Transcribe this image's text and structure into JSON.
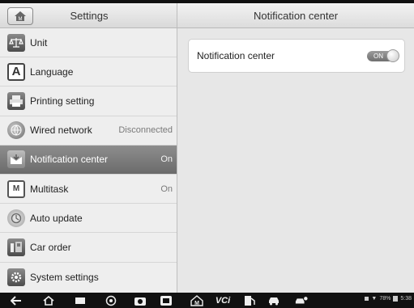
{
  "left_panel": {
    "title": "Settings",
    "items": [
      {
        "label": "Unit",
        "value": "",
        "icon": "scale-icon"
      },
      {
        "label": "Language",
        "value": "",
        "icon": "language-icon"
      },
      {
        "label": "Printing setting",
        "value": "",
        "icon": "printer-icon"
      },
      {
        "label": "Wired network",
        "value": "Disconnected",
        "icon": "network-globe-icon"
      },
      {
        "label": "Notification center",
        "value": "On",
        "icon": "notification-icon"
      },
      {
        "label": "Multitask",
        "value": "On",
        "icon": "multitask-icon"
      },
      {
        "label": "Auto update",
        "value": "",
        "icon": "auto-update-icon"
      },
      {
        "label": "Car order",
        "value": "",
        "icon": "car-order-icon"
      },
      {
        "label": "System settings",
        "value": "",
        "icon": "gear-icon"
      }
    ],
    "selected_index": 4
  },
  "right_panel": {
    "title": "Notification center",
    "setting": {
      "label": "Notification center",
      "toggle": "ON"
    }
  },
  "status_bar": {
    "text": "78%",
    "time": "5:38"
  }
}
